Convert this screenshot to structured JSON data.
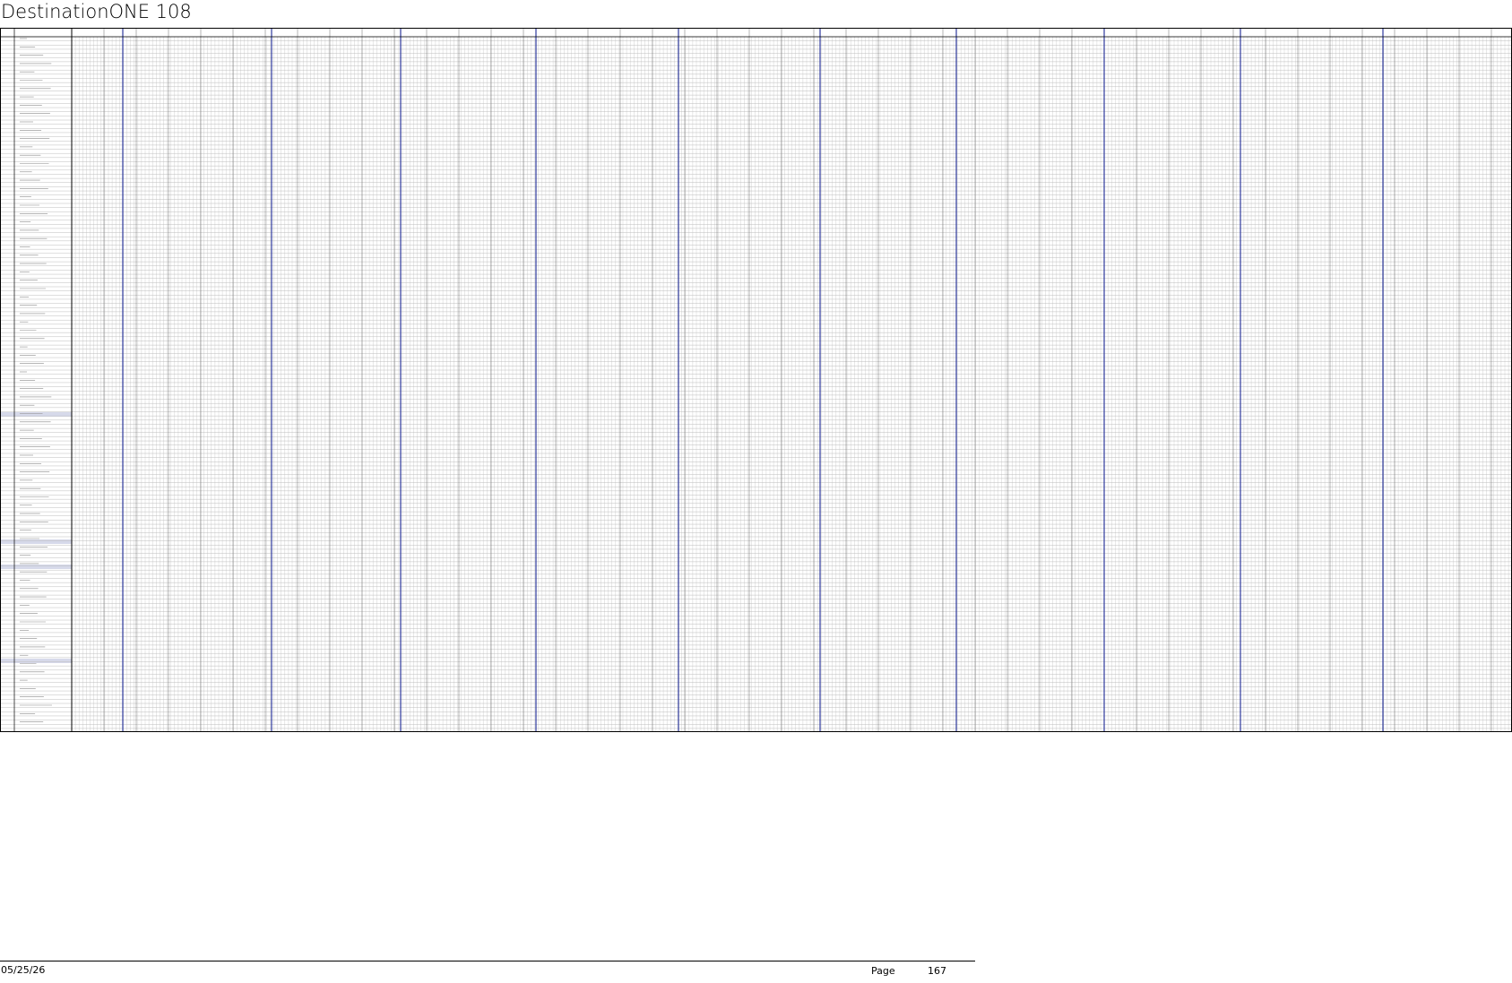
{
  "document": {
    "title": "DestinationONE 108"
  },
  "footer": {
    "date": "05/25/26",
    "page_label": "Page",
    "page_number": "167"
  },
  "colors": {
    "grid_line": "#bdbdbd",
    "row_line": "#6b6b6b",
    "section_divider": "#2e3a9c",
    "row_highlight": "#d6d9ea",
    "text": "#000000"
  }
}
